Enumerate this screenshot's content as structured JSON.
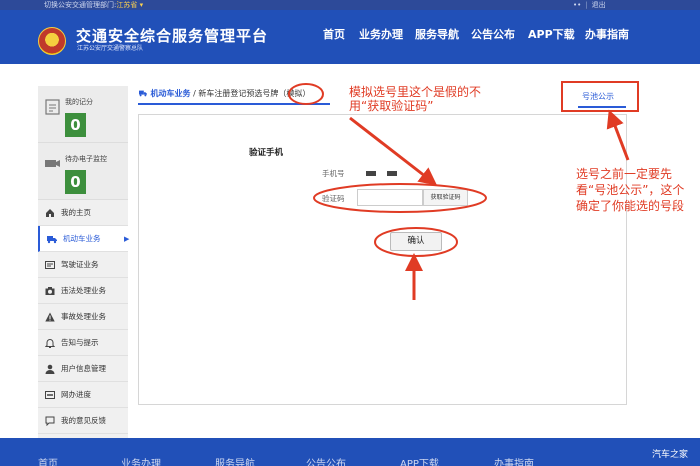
{
  "topbar": {
    "region_label": "切换公安交通管理部门:",
    "region_value": "江苏省 ▾",
    "user_masked": "••",
    "separator": "|",
    "logout": "退出"
  },
  "header": {
    "title": "交通安全综合服务管理平台",
    "subtitle": "江苏公安厅交通警察总队",
    "nav": [
      "首页",
      "业务办理",
      "服务导航",
      "公告公布",
      "APP下载",
      "办事指南"
    ]
  },
  "sidebar": {
    "stats": [
      {
        "label": "我的记分",
        "value": "0",
        "icon": "clipboard-icon"
      },
      {
        "label": "待办电子监控",
        "value": "0",
        "icon": "camera-icon"
      }
    ],
    "items": [
      {
        "label": "我的主页",
        "icon": "home-icon"
      },
      {
        "label": "机动车业务",
        "icon": "truck-icon",
        "active": true
      },
      {
        "label": "驾驶证业务",
        "icon": "license-card-icon"
      },
      {
        "label": "违法处理业务",
        "icon": "camera-icon"
      },
      {
        "label": "事故处理业务",
        "icon": "warning-icon"
      },
      {
        "label": "告知与提示",
        "icon": "bell-icon"
      },
      {
        "label": "用户信息管理",
        "icon": "user-icon"
      },
      {
        "label": "网办进度",
        "icon": "progress-icon"
      },
      {
        "label": "我的意见反馈",
        "icon": "feedback-icon"
      }
    ]
  },
  "breadcrumb": {
    "section": "机动车业务",
    "separator": "/",
    "page": "新车注册登记预选号牌",
    "tag": "（模拟）"
  },
  "pool_tab": "号池公示",
  "form": {
    "title": "验证手机",
    "phone_label": "手机号",
    "code_label": "验证码",
    "code_value": "",
    "get_code_button": "获取验证码",
    "confirm_button": "确认"
  },
  "annotations": {
    "note_1": "模拟选号里这个是假的不用“获取验证码”",
    "note_2": "选号之前一定要先看“号池公示”，这个确定了你能选的号段"
  },
  "footer": {
    "nav": [
      "首页",
      "业务办理",
      "服务导航",
      "公告公布",
      "APP下载",
      "办事指南"
    ]
  },
  "watermark": "汽车之家",
  "colors": {
    "header_bg": "#2150b8",
    "accent_blue": "#2a5bd7",
    "annotation_red": "#e03b24",
    "count_green": "#3d8f3d"
  }
}
